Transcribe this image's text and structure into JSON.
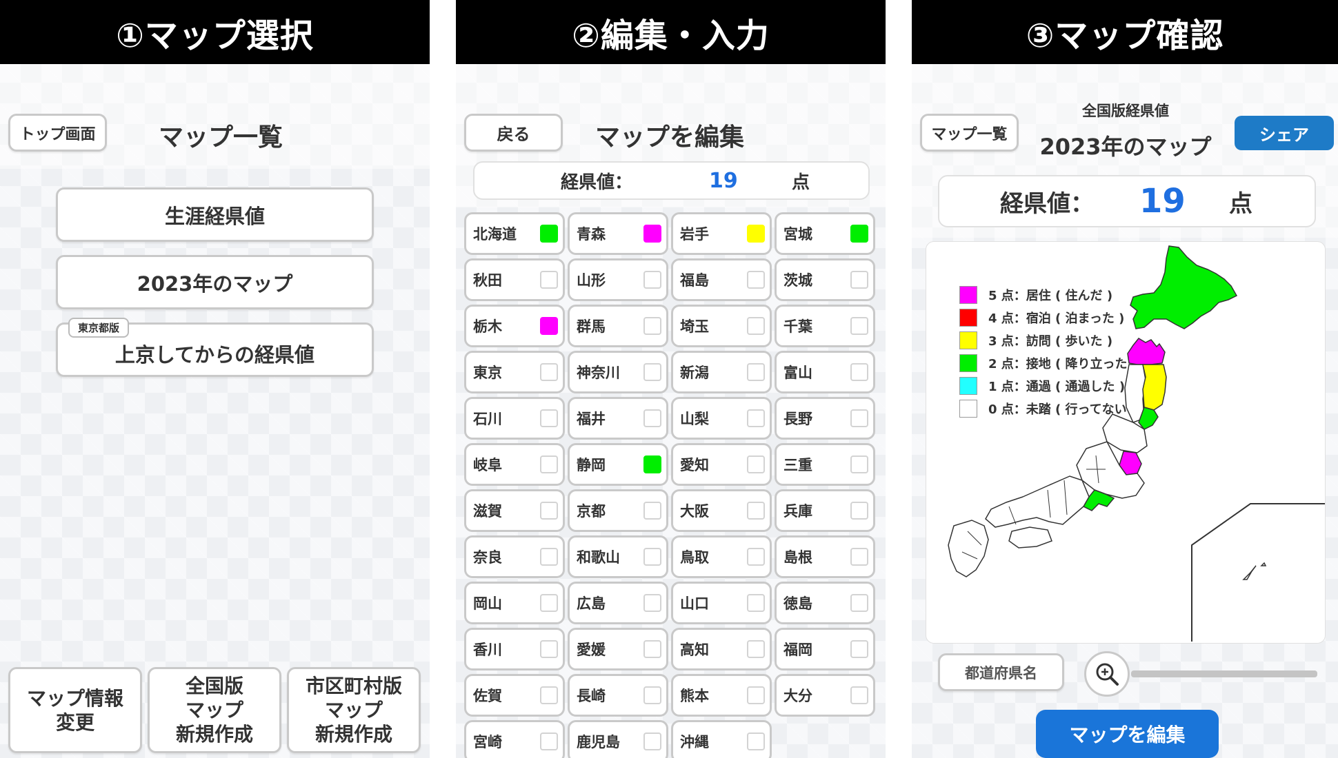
{
  "panel1": {
    "header": "①マップ選択",
    "top_button": "トップ画面",
    "title": "マップ一覧",
    "maps": [
      {
        "label": "生涯経県値"
      },
      {
        "label": "2023年のマップ"
      },
      {
        "label": "上京してからの経県値",
        "tag": "東京都版"
      }
    ],
    "bottom_buttons": [
      {
        "lines": [
          "マップ情報",
          "変更"
        ]
      },
      {
        "lines": [
          "全国版",
          "マップ",
          "新規作成"
        ]
      },
      {
        "lines": [
          "市区町村版",
          "マップ",
          "新規作成"
        ]
      }
    ]
  },
  "panel2": {
    "header": "②編集・入力",
    "back_button": "戻る",
    "title": "マップを編集",
    "score": {
      "label": "経県値：",
      "value": "19",
      "unit": "点"
    },
    "prefectures": [
      {
        "name": "北海道",
        "color": "#00ee00"
      },
      {
        "name": "青森",
        "color": "#ff00ff"
      },
      {
        "name": "岩手",
        "color": "#ffff00"
      },
      {
        "name": "宮城",
        "color": "#00ee00"
      },
      {
        "name": "秋田",
        "color": ""
      },
      {
        "name": "山形",
        "color": ""
      },
      {
        "name": "福島",
        "color": ""
      },
      {
        "name": "茨城",
        "color": ""
      },
      {
        "name": "栃木",
        "color": "#ff00ff"
      },
      {
        "name": "群馬",
        "color": ""
      },
      {
        "name": "埼玉",
        "color": ""
      },
      {
        "name": "千葉",
        "color": ""
      },
      {
        "name": "東京",
        "color": ""
      },
      {
        "name": "神奈川",
        "color": ""
      },
      {
        "name": "新潟",
        "color": ""
      },
      {
        "name": "富山",
        "color": ""
      },
      {
        "name": "石川",
        "color": ""
      },
      {
        "name": "福井",
        "color": ""
      },
      {
        "name": "山梨",
        "color": ""
      },
      {
        "name": "長野",
        "color": ""
      },
      {
        "name": "岐阜",
        "color": ""
      },
      {
        "name": "静岡",
        "color": "#00ee00"
      },
      {
        "name": "愛知",
        "color": ""
      },
      {
        "name": "三重",
        "color": ""
      },
      {
        "name": "滋賀",
        "color": ""
      },
      {
        "name": "京都",
        "color": ""
      },
      {
        "name": "大阪",
        "color": ""
      },
      {
        "name": "兵庫",
        "color": ""
      },
      {
        "name": "奈良",
        "color": ""
      },
      {
        "name": "和歌山",
        "color": ""
      },
      {
        "name": "鳥取",
        "color": ""
      },
      {
        "name": "島根",
        "color": ""
      },
      {
        "name": "岡山",
        "color": ""
      },
      {
        "name": "広島",
        "color": ""
      },
      {
        "name": "山口",
        "color": ""
      },
      {
        "name": "徳島",
        "color": ""
      },
      {
        "name": "香川",
        "color": ""
      },
      {
        "name": "愛媛",
        "color": ""
      },
      {
        "name": "高知",
        "color": ""
      },
      {
        "name": "福岡",
        "color": ""
      },
      {
        "name": "佐賀",
        "color": ""
      },
      {
        "name": "長崎",
        "color": ""
      },
      {
        "name": "熊本",
        "color": ""
      },
      {
        "name": "大分",
        "color": ""
      },
      {
        "name": "宮崎",
        "color": ""
      },
      {
        "name": "鹿児島",
        "color": ""
      },
      {
        "name": "沖縄",
        "color": ""
      }
    ]
  },
  "panel3": {
    "header": "③マップ確認",
    "back_button": "マップ一覧",
    "subtitle": "全国版経県値",
    "title": "2023年のマップ",
    "share_button": "シェア",
    "score": {
      "label": "経県値：",
      "value": "19",
      "unit": "点"
    },
    "legend": [
      {
        "text": "5 点：居住 ( 住んだ )",
        "color": "#ff00ff"
      },
      {
        "text": "4 点：宿泊 ( 泊まった )",
        "color": "#ff0000"
      },
      {
        "text": "3 点：訪問 ( 歩いた )",
        "color": "#ffff00"
      },
      {
        "text": "2 点：接地 ( 降り立った )",
        "color": "#00ee00"
      },
      {
        "text": "1 点：通過 ( 通過した )",
        "color": "#22ffff"
      },
      {
        "text": "0 点：未踏 ( 行ってない )",
        "color": "#ffffff"
      }
    ],
    "pref_name_button": "都道府県名",
    "edit_button": "マップを編集"
  }
}
